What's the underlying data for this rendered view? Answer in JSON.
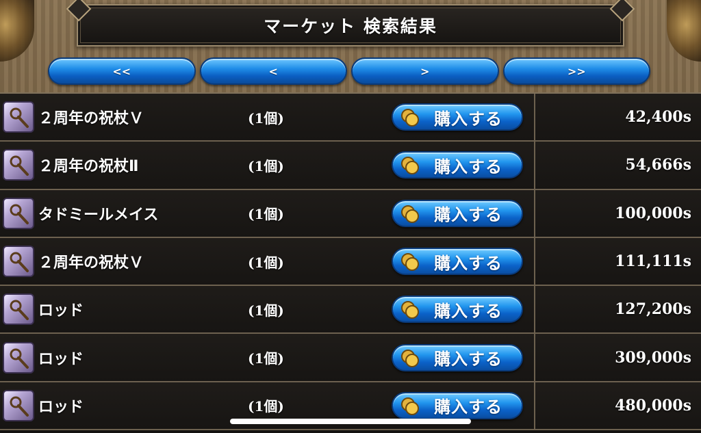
{
  "title": "マーケット 検索結果",
  "pager": {
    "first": "<<",
    "prev": "<",
    "next": ">",
    "last": ">>"
  },
  "buy_label": "購入する",
  "items": [
    {
      "name": "２周年の祝杖Ｖ",
      "qty": "(1個)",
      "price": "42,400s"
    },
    {
      "name": "２周年の祝杖Ⅱ",
      "qty": "(1個)",
      "price": "54,666s"
    },
    {
      "name": "タドミールメイス",
      "qty": "(1個)",
      "price": "100,000s"
    },
    {
      "name": "２周年の祝杖Ｖ",
      "qty": "(1個)",
      "price": "111,111s"
    },
    {
      "name": "ロッド",
      "qty": "(1個)",
      "price": "127,200s"
    },
    {
      "name": "ロッド",
      "qty": "(1個)",
      "price": "309,000s"
    },
    {
      "name": "ロッド",
      "qty": "(1個)",
      "price": "480,000s"
    }
  ],
  "icons": {
    "item": "staff-icon",
    "buy": "coin-icon"
  }
}
